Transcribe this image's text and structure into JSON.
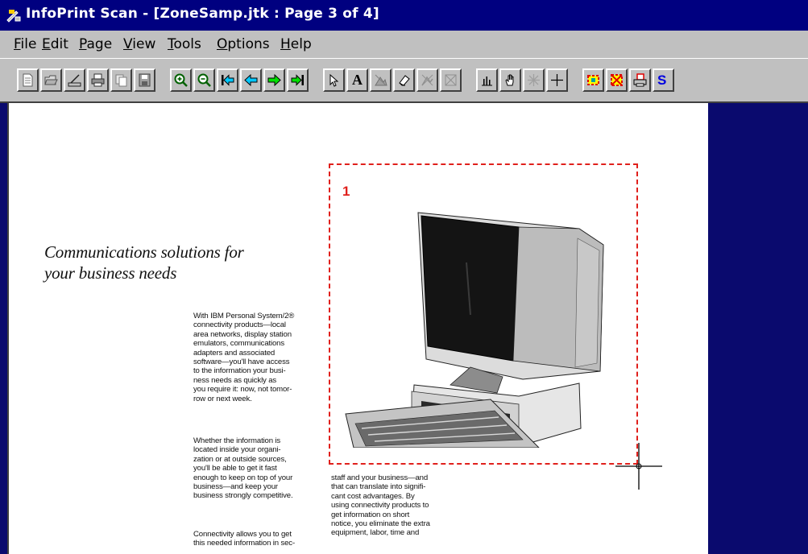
{
  "window": {
    "title": "InfoPrint Scan - [ZoneSamp.jtk : Page 3 of 4]"
  },
  "menu": [
    {
      "label": "File",
      "mnemonic": "F",
      "rest": "ile"
    },
    {
      "label": "Edit",
      "mnemonic": "E",
      "rest": "dit"
    },
    {
      "label": "Page",
      "mnemonic": "P",
      "rest": "age"
    },
    {
      "label": "View",
      "mnemonic": "V",
      "rest": "iew"
    },
    {
      "label": "Tools",
      "mnemonic": "T",
      "rest": "ools"
    },
    {
      "label": "Options",
      "mnemonic": "O",
      "rest": "ptions"
    },
    {
      "label": "Help",
      "mnemonic": "H",
      "rest": "elp"
    }
  ],
  "toolbar": {
    "buttons": [
      {
        "icon": "new-document-icon"
      },
      {
        "icon": "open-folder-icon"
      },
      {
        "icon": "scan-icon"
      },
      {
        "icon": "print-icon"
      },
      {
        "icon": "copy-page-icon"
      },
      {
        "icon": "save-icon"
      },
      {
        "icon": "zoom-in-icon"
      },
      {
        "icon": "zoom-out-icon"
      },
      {
        "icon": "first-page-icon"
      },
      {
        "icon": "previous-page-icon"
      },
      {
        "icon": "next-page-icon"
      },
      {
        "icon": "last-page-icon"
      },
      {
        "icon": "select-arrow-icon"
      },
      {
        "icon": "text-zone-icon",
        "text": "A"
      },
      {
        "icon": "graphic-zone-icon"
      },
      {
        "icon": "eraser-icon"
      },
      {
        "icon": "delete-zone-icon"
      },
      {
        "icon": "clear-zones-icon"
      },
      {
        "icon": "histogram-icon"
      },
      {
        "icon": "hand-pan-icon"
      },
      {
        "icon": "deskew-icon"
      },
      {
        "icon": "crosshair-icon"
      },
      {
        "icon": "auto-zone-icon"
      },
      {
        "icon": "remove-zones-icon"
      },
      {
        "icon": "recognize-icon"
      },
      {
        "icon": "spell-check-icon",
        "text": "S"
      }
    ]
  },
  "page": {
    "headline": [
      "Communications solutions for",
      "your business needs"
    ],
    "zone_label": "1",
    "column1": {
      "para1": [
        "With IBM Personal System/2®",
        "connectivity products—local",
        "area networks, display station",
        "emulators, communications",
        "adapters and associated",
        "software—you'll have access",
        "to the information your busi-",
        "ness needs as quickly as",
        "you require it: now, not tomor-",
        "row or next week."
      ],
      "para2": [
        "Whether the information is",
        "located inside your organi-",
        "zation or at outside sources,",
        "you'll be able to get it fast",
        "enough to keep on top of your",
        "business—and keep your",
        "business strongly competitive."
      ],
      "para3": [
        "Connectivity allows you to get",
        "this needed information in sec-"
      ]
    },
    "column2": [
      "staff and your business—and",
      "that can translate into signifi-",
      "cant cost advantages. By",
      "using connectivity products to",
      "get information on short",
      "notice, you eliminate the extra",
      "equipment, labor, time and"
    ]
  },
  "colors": {
    "title_bar": "#000080",
    "workspace_bg": "#0a0a6e",
    "zone_border": "#e0201c"
  }
}
